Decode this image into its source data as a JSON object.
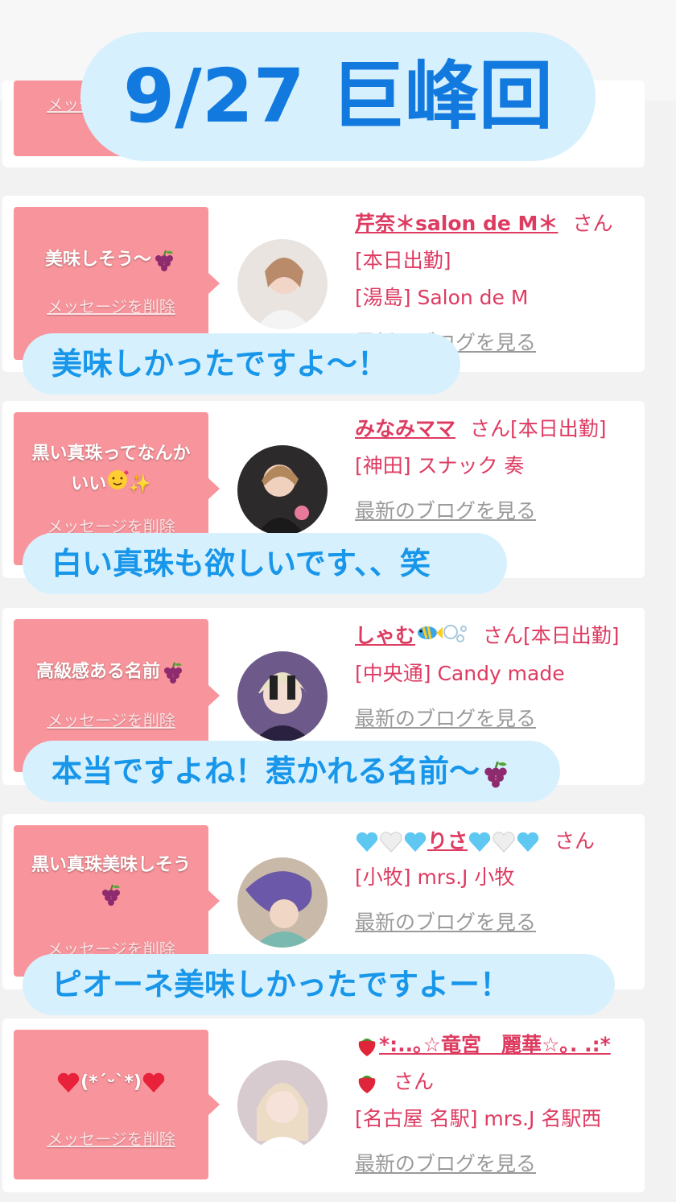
{
  "title": "9/27 巨峰回",
  "cards": [
    {
      "message": "美味しそう〜",
      "delete_label": "メッセージを削除",
      "name": "芹奈＊salon de M＊",
      "san": "さん",
      "status": "[本日出勤]",
      "shop": "[湯島] Salon de M",
      "blog_label": "最新のブログを見る",
      "reply": "美味しかったですよ〜！"
    },
    {
      "message": "黒い真珠ってなんかいい",
      "delete_label": "メッセージを削除",
      "name": "みなみママ",
      "san": "さん",
      "status": "[本日出勤]",
      "shop": "[神田] スナック 奏",
      "blog_label": "最新のブログを見る",
      "reply": "白い真珠も欲しいです、、笑"
    },
    {
      "message": "高級感ある名前",
      "delete_label": "メッセージを削除",
      "name": "しゃむ",
      "san": "さん",
      "status": "[本日出勤]",
      "shop": "[中央通] Candy made",
      "blog_label": "最新のブログを見る",
      "reply": "本当ですよね！惹かれる名前〜"
    },
    {
      "message": "黒い真珠美味しそう",
      "delete_label": "メッセージを削除",
      "name": "りさ",
      "san": "さん",
      "shop": "[小牧] mrs.J 小牧",
      "blog_label": "最新のブログを見る",
      "reply": "ピオーネ美味しかったですよー！"
    },
    {
      "message": "(*´ᵕ`*)",
      "delete_label": "メッセージを削除",
      "name": "*:..｡☆竜宮　麗華☆｡. .:*",
      "san": "さん",
      "shop": "[名古屋 名駅] mrs.J 名駅西",
      "blog_label": "最新のブログを見る"
    }
  ],
  "colors": {
    "pink": "#f8949b",
    "rose": "#de3b61",
    "bubble": "#d6f1fd",
    "blue": "#1896ea"
  }
}
